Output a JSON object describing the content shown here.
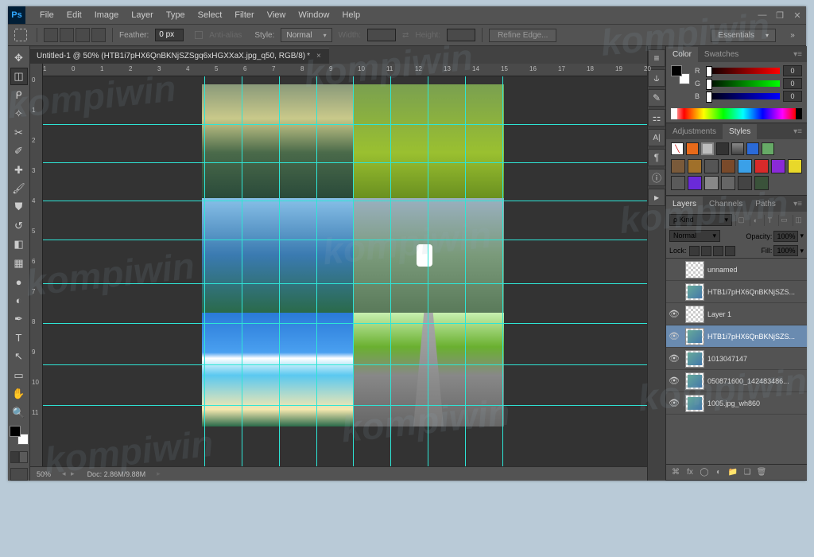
{
  "menu": [
    "File",
    "Edit",
    "Image",
    "Layer",
    "Type",
    "Select",
    "Filter",
    "View",
    "Window",
    "Help"
  ],
  "workspace": "Essentials",
  "options": {
    "feather_label": "Feather:",
    "feather_value": "0 px",
    "antialias": "Anti-alias",
    "style_label": "Style:",
    "style_value": "Normal",
    "width_label": "Width:",
    "height_label": "Height:",
    "refine": "Refine Edge..."
  },
  "doc": {
    "tab": "Untitled-1 @ 50% (HTB1i7pHX6QnBKNjSZSgq6xHGXXaX.jpg_q50, RGB/8)",
    "zoom": "50%",
    "docsize": "Doc: 2.86M/9.88M"
  },
  "ruler_h": [
    "1",
    "0",
    "1",
    "2",
    "3",
    "4",
    "5",
    "6",
    "7",
    "8",
    "9",
    "10",
    "11",
    "12",
    "13",
    "14",
    "15",
    "16",
    "17",
    "18",
    "19",
    "20",
    "2"
  ],
  "ruler_v": [
    "0",
    "1",
    "2",
    "3",
    "4",
    "5",
    "6",
    "7",
    "8",
    "9",
    "10",
    "11"
  ],
  "guides_h": [
    60,
    108,
    156,
    205,
    260,
    310,
    362,
    413
  ],
  "guides_v": [
    203,
    250,
    297,
    344,
    390,
    437,
    484,
    531,
    578
  ],
  "panels": {
    "color": {
      "tab1": "Color",
      "tab2": "Swatches",
      "r": "R",
      "g": "G",
      "b": "B",
      "v": "0"
    },
    "adj": {
      "tab1": "Adjustments",
      "tab2": "Styles"
    },
    "layers": {
      "tab1": "Layers",
      "tab2": "Channels",
      "tab3": "Paths",
      "kind_label": "ρ Kind",
      "blend": "Normal",
      "opacity_label": "Opacity:",
      "opacity": "100%",
      "lock_label": "Lock:",
      "fill_label": "Fill:",
      "fill": "100%",
      "items": [
        {
          "vis": "",
          "name": "unnamed",
          "sel": false,
          "img": false
        },
        {
          "vis": "",
          "name": "HTB1i7pHX6QnBKNjSZS...",
          "sel": false,
          "img": true
        },
        {
          "vis": "👁",
          "name": "Layer 1",
          "sel": false,
          "img": false
        },
        {
          "vis": "👁",
          "name": "HTB1i7pHX6QnBKNjSZS...",
          "sel": true,
          "img": true
        },
        {
          "vis": "👁",
          "name": "1013047147",
          "sel": false,
          "img": true
        },
        {
          "vis": "👁",
          "name": "050871600_142483486...",
          "sel": false,
          "img": true
        },
        {
          "vis": "👁",
          "name": "1005.jpg_wh860",
          "sel": false,
          "img": true
        }
      ]
    }
  },
  "watermark": "kompiwin"
}
